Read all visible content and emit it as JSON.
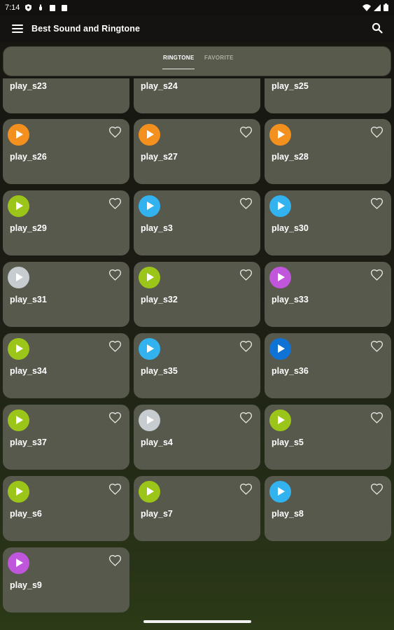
{
  "status": {
    "time": "7:14"
  },
  "appbar": {
    "title": "Best Sound and Ringtone"
  },
  "tabs": [
    {
      "label": "RINGTONE"
    },
    {
      "label": "FAVORITE"
    }
  ],
  "colors": {
    "orange": "#f4901e",
    "green": "#9cc51a",
    "sky": "#32b3ef",
    "grey": "#c7ccd0",
    "purple": "#c056dc",
    "blue": "#0f73d6",
    "card": "#58594d"
  },
  "sounds": [
    {
      "name": "play_s23"
    },
    {
      "name": "play_s24"
    },
    {
      "name": "play_s25"
    },
    {
      "name": "play_s26",
      "color": "orange"
    },
    {
      "name": "play_s27",
      "color": "orange"
    },
    {
      "name": "play_s28",
      "color": "orange"
    },
    {
      "name": "play_s29",
      "color": "green"
    },
    {
      "name": "play_s3",
      "color": "sky"
    },
    {
      "name": "play_s30",
      "color": "sky"
    },
    {
      "name": "play_s31",
      "color": "grey"
    },
    {
      "name": "play_s32",
      "color": "green"
    },
    {
      "name": "play_s33",
      "color": "purple"
    },
    {
      "name": "play_s34",
      "color": "green"
    },
    {
      "name": "play_s35",
      "color": "sky"
    },
    {
      "name": "play_s36",
      "color": "blue"
    },
    {
      "name": "play_s37",
      "color": "green"
    },
    {
      "name": "play_s4",
      "color": "grey"
    },
    {
      "name": "play_s5",
      "color": "green"
    },
    {
      "name": "play_s6",
      "color": "green"
    },
    {
      "name": "play_s7",
      "color": "green"
    },
    {
      "name": "play_s8",
      "color": "sky"
    },
    {
      "name": "play_s9",
      "color": "purple"
    }
  ]
}
